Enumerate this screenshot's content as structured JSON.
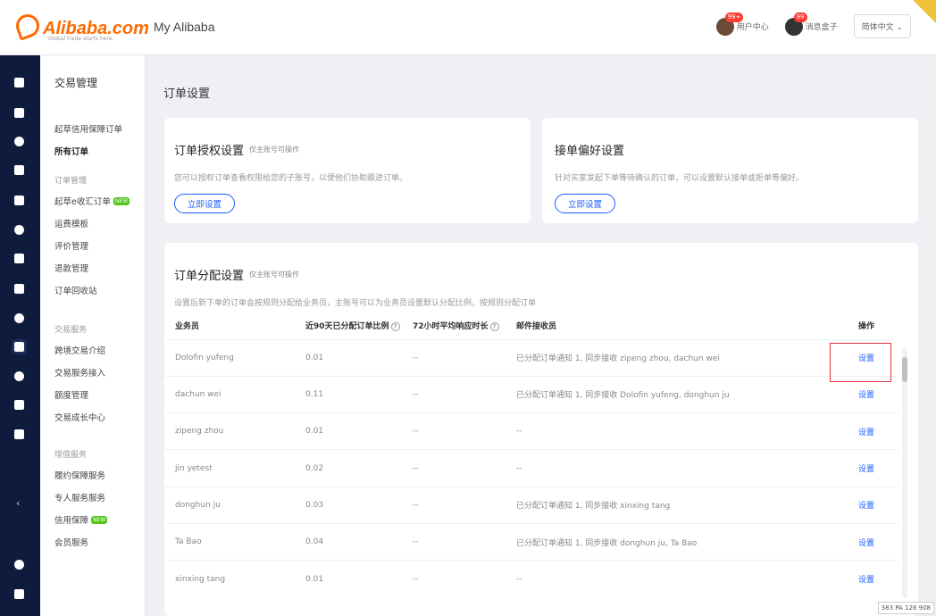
{
  "header": {
    "logo_text": "Alibaba.com",
    "logo_sub": "Global trade starts here.",
    "app_title": "My Alibaba",
    "user_center_label": "用户中心",
    "user_center_badge": "99+",
    "messages_label": "消息盒子",
    "messages_badge": "99",
    "lang_button": "简体中文 ⌄"
  },
  "rail": {
    "collapse_icon": "chevron-left-icon"
  },
  "sidebar": {
    "title": "交易管理",
    "items": [
      {
        "label": "起草信用保障订单",
        "type": "item"
      },
      {
        "label": "所有订单",
        "type": "active"
      },
      {
        "label": "订单管理",
        "type": "group"
      },
      {
        "label": "起草e收汇订单",
        "type": "item",
        "tag": "NEW"
      },
      {
        "label": "运费模板",
        "type": "item"
      },
      {
        "label": "评价管理",
        "type": "item"
      },
      {
        "label": "退款管理",
        "type": "item"
      },
      {
        "label": "订单回收站",
        "type": "item"
      },
      {
        "label": "交易服务",
        "type": "group"
      },
      {
        "label": "跨境交易介绍",
        "type": "item"
      },
      {
        "label": "交易服务接入",
        "type": "item"
      },
      {
        "label": "额度管理",
        "type": "item"
      },
      {
        "label": "交易成长中心",
        "type": "item"
      },
      {
        "label": "增值服务",
        "type": "group"
      },
      {
        "label": "履约保障服务",
        "type": "item"
      },
      {
        "label": "专人服务服务",
        "type": "item"
      },
      {
        "label": "信用保障",
        "type": "item",
        "tag": "NEW"
      },
      {
        "label": "会员服务",
        "type": "item"
      }
    ]
  },
  "main": {
    "page_title": "订单设置",
    "auth_card": {
      "title": "订单授权设置",
      "tip": "仅主账号可操作",
      "desc": "您可以授权订单查看权限给您的子账号，以便他们协助跟进订单。",
      "button": "立即设置"
    },
    "accept_card": {
      "title": "接单偏好设置",
      "desc": "针对买家发起下单等待确认的订单，可以设置默认接单或拒单等偏好。",
      "button": "立即设置"
    },
    "assign_card": {
      "title": "订单分配设置",
      "tip": "仅主账号可操作",
      "desc": "设置后新下单的订单会按规则分配给业务员，主账号可以为业务员设置默认分配比例，按规则分配订单",
      "columns": [
        "业务员",
        "近90天已分配订单比例",
        "72小时平均响应时长",
        "邮件接收员",
        "操作"
      ],
      "rows": [
        {
          "name": "Dolofin yufeng",
          "rate": "0.01",
          "time": "--",
          "recipients": "已分配订单通知 1, 同步接收 zipeng zhou, dachun wei",
          "action": "设置"
        },
        {
          "name": "dachun wei",
          "rate": "0.11",
          "time": "--",
          "recipients": "已分配订单通知 1, 同步接收 Dolofin yufeng, donghun ju",
          "action": "设置"
        },
        {
          "name": "zipeng zhou",
          "rate": "0.01",
          "time": "--",
          "recipients": "--",
          "action": "设置"
        },
        {
          "name": "jin yetest",
          "rate": "0.02",
          "time": "--",
          "recipients": "--",
          "action": "设置"
        },
        {
          "name": "donghun ju",
          "rate": "0.03",
          "time": "--",
          "recipients": "已分配订单通知 1, 同步接收 xinxing tang",
          "action": "设置"
        },
        {
          "name": "Ta Bao",
          "rate": "0.04",
          "time": "--",
          "recipients": "已分配订单通知 1, 同步接收 donghun ju, Ta Bao",
          "action": "设置"
        },
        {
          "name": "xinxing tang",
          "rate": "0.01",
          "time": "--",
          "recipients": "--",
          "action": "设置"
        }
      ]
    }
  },
  "statusbar": "383 PA 126 908"
}
